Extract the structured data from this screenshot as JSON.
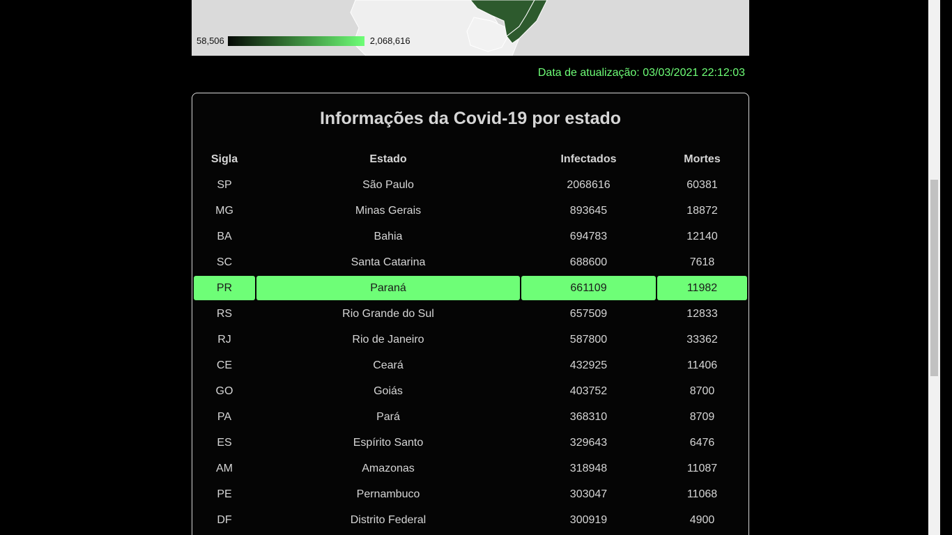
{
  "map": {
    "legend_min": "58,506",
    "legend_max": "2,068,616",
    "colors": {
      "low": "#050805",
      "high": "#6efe77",
      "state_fill": "#2d5a2d"
    }
  },
  "update": {
    "text": "Data de atualização: 03/03/2021 22:12:03",
    "color": "#6efe77"
  },
  "table": {
    "title": "Informações da Covid-19 por estado",
    "headers": [
      "Sigla",
      "Estado",
      "Infectados",
      "Mortes"
    ],
    "highlight_color": "#6efe77",
    "rows": [
      [
        "SP",
        "São Paulo",
        "2068616",
        "60381"
      ],
      [
        "MG",
        "Minas Gerais",
        "893645",
        "18872"
      ],
      [
        "BA",
        "Bahia",
        "694783",
        "12140"
      ],
      [
        "SC",
        "Santa Catarina",
        "688600",
        "7618"
      ],
      [
        "PR",
        "Paraná",
        "661109",
        "11982"
      ],
      [
        "RS",
        "Rio Grande do Sul",
        "657509",
        "12833"
      ],
      [
        "RJ",
        "Rio de Janeiro",
        "587800",
        "33362"
      ],
      [
        "CE",
        "Ceará",
        "432925",
        "11406"
      ],
      [
        "GO",
        "Goiás",
        "403752",
        "8700"
      ],
      [
        "PA",
        "Pará",
        "368310",
        "8709"
      ],
      [
        "ES",
        "Espírito Santo",
        "329643",
        "6476"
      ],
      [
        "AM",
        "Amazonas",
        "318948",
        "11087"
      ],
      [
        "PE",
        "Pernambuco",
        "303047",
        "11068"
      ],
      [
        "DF",
        "Distrito Federal",
        "300919",
        "4900"
      ]
    ]
  }
}
